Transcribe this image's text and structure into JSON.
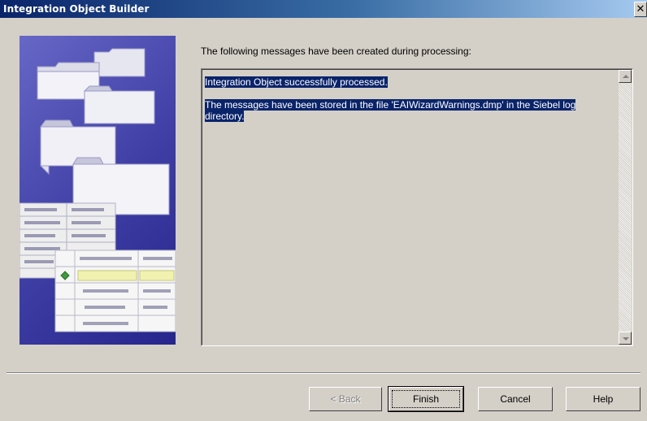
{
  "window": {
    "title": "Integration Object Builder",
    "close_glyph": "✕"
  },
  "main": {
    "heading": "The following messages have been created during processing:",
    "messages": {
      "line1": "Integration Object successfully processed.",
      "line2": "The messages have been stored in the file 'EAIWizardWarnings.dmp' in the Siebel log directory."
    }
  },
  "buttons": {
    "back": "< Back",
    "finish": "Finish",
    "cancel": "Cancel",
    "help": "Help"
  },
  "colors": {
    "dialog_bg": "#d4d0c8",
    "titlebar_start": "#0a246a",
    "titlebar_end": "#a6caf0",
    "selection_bg": "#0a246a",
    "art_bg": "#3d3da4"
  },
  "icons": [
    "close-icon",
    "scroll-up-icon",
    "scroll-down-icon",
    "wizard-illustration"
  ]
}
